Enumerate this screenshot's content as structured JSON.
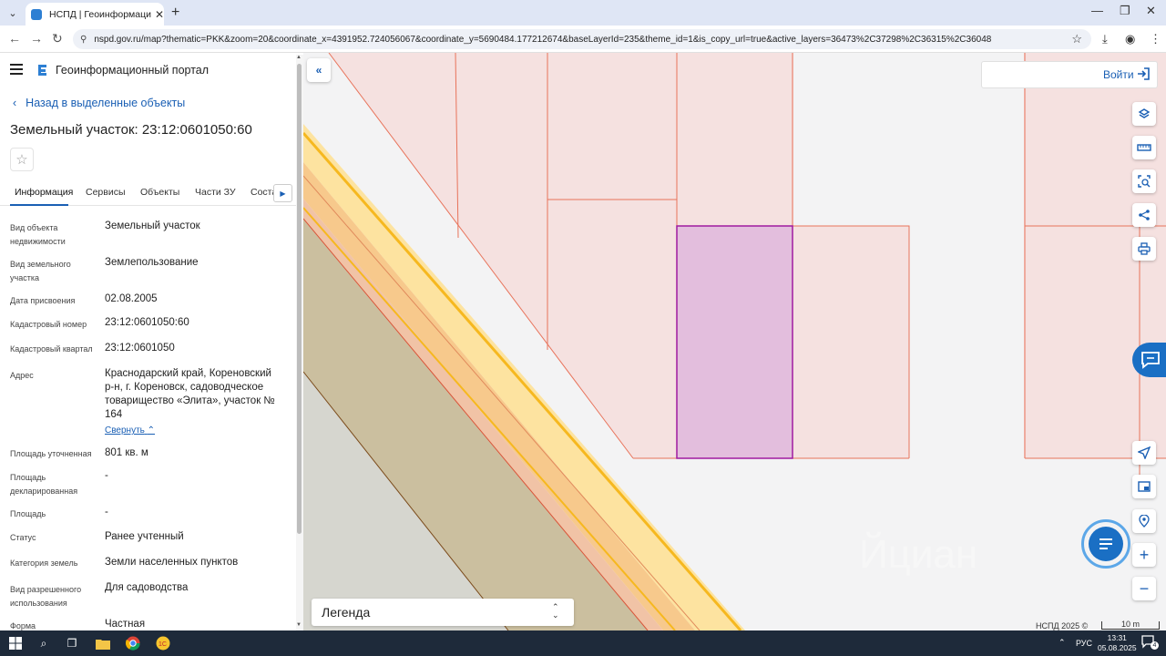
{
  "browser": {
    "tab_title": "НСПД | Геоинформационный",
    "url": "nspd.gov.ru/map?thematic=PKK&zoom=20&coordinate_x=4391952.724056067&coordinate_y=5690484.177212674&baseLayerId=235&theme_id=1&is_copy_url=true&active_layers=36473%2C37298%2C36315%2C36048"
  },
  "panel": {
    "portal_title": "Геоинформационный портал",
    "back_label": "Назад в выделенные объекты",
    "object_title": "Земельный участок: 23:12:0601050:60",
    "tabs": [
      "Информация",
      "Сервисы",
      "Объекты",
      "Части ЗУ",
      "Соста"
    ],
    "properties": [
      {
        "label": "Вид объекта недвижимости",
        "value": "Земельный участок"
      },
      {
        "label": "Вид земельного участка",
        "value": "Землепользование"
      },
      {
        "label": "Дата присвоения",
        "value": "02.08.2005"
      },
      {
        "label": "Кадастровый номер",
        "value": "23:12:0601050:60"
      },
      {
        "label": "Кадастровый квартал",
        "value": "23:12:0601050"
      },
      {
        "label": "Адрес",
        "value": "Краснодарский край, Кореновский р-н, г. Кореновск, садоводческое товарищество «Элита», участок № 164"
      },
      {
        "label": "Площадь уточненная",
        "value": "801 кв. м"
      },
      {
        "label": "Площадь декларированная",
        "value": "-"
      },
      {
        "label": "Площадь",
        "value": "-"
      },
      {
        "label": "Статус",
        "value": "Ранее учтенный"
      },
      {
        "label": "Категория земель",
        "value": "Земли населенных пунктов"
      },
      {
        "label": "Вид разрешенного использования",
        "value": "Для садоводства"
      },
      {
        "label": "Форма собственности",
        "value": "Частная"
      }
    ],
    "collapse_label": "Свернуть"
  },
  "map": {
    "login_label": "Войти",
    "legend_label": "Легенда",
    "copyright": "НСПД 2025 ©",
    "scale_label": "10 m",
    "colors": {
      "parcel_fill": "#f5e1e0",
      "parcel_border": "#e8735a",
      "selected_fill": "#e3bedd",
      "selected_border": "#a01aa0",
      "road_yellow": "#fde3a0",
      "road_orange": "#f7c98c",
      "khaki": "#cbbf9f",
      "grey_land": "#d6d6cf"
    }
  },
  "taskbar": {
    "lang": "РУС",
    "time": "13:31",
    "date": "05.08.2025",
    "notif_count": "4"
  }
}
